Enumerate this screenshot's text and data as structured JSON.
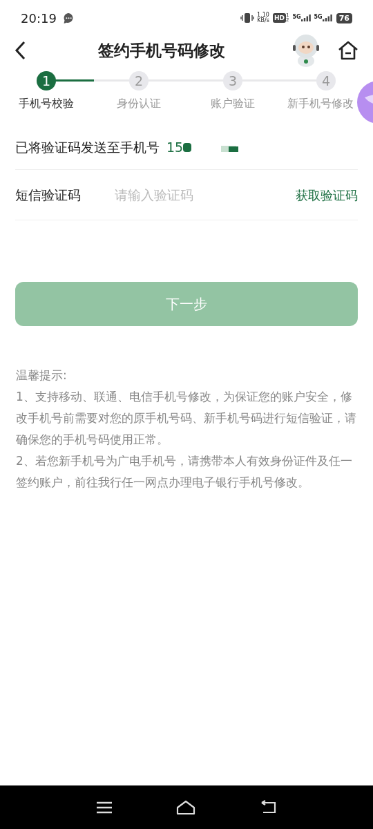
{
  "status_bar": {
    "time": "20:19",
    "speed_value": "1.10",
    "speed_unit": "KB/s",
    "hd": "HD",
    "sim_1": "1",
    "sim_2": "2",
    "network_1": "5G",
    "network_2": "5G",
    "battery": "76"
  },
  "header": {
    "title": "签约手机号码修改"
  },
  "steps": [
    {
      "number": "1",
      "label": "手机号校验",
      "selected": true
    },
    {
      "number": "2",
      "label": "身份认证",
      "selected": false
    },
    {
      "number": "3",
      "label": "账户验证",
      "selected": false
    },
    {
      "number": "4",
      "label": "新手机号修改",
      "selected": false
    }
  ],
  "sent_row": {
    "label": "已将验证码发送至手机号",
    "phone_visible": "15"
  },
  "code_row": {
    "label": "短信验证码",
    "placeholder": "请输入验证码",
    "action": "获取验证码"
  },
  "next_button": {
    "label": "下一步",
    "disabled": true
  },
  "tips": {
    "title": "温馨提示:",
    "items": [
      "1、支持移动、联通、电信手机号修改，为保证您的账户安全，修改手机号前需要对您的原手机号码、新手机号码进行短信验证，请确保您的手机号码使用正常。",
      "2、若您新手机号为广电手机号，请携带本人有效身份证件及任一签约账户，前往我行任一网点办理电子银行手机号修改。"
    ]
  }
}
